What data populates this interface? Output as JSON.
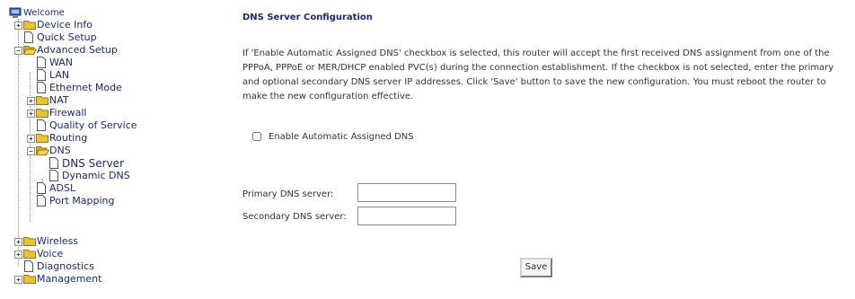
{
  "sidebar": {
    "items": [
      {
        "label": "Welcome"
      },
      {
        "label": "Device Info"
      },
      {
        "label": "Quick Setup"
      },
      {
        "label": "Advanced Setup"
      },
      {
        "label": "WAN"
      },
      {
        "label": "LAN"
      },
      {
        "label": "Ethernet Mode"
      },
      {
        "label": "NAT"
      },
      {
        "label": "Firewall"
      },
      {
        "label": "Quality of Service"
      },
      {
        "label": "Routing"
      },
      {
        "label": "DNS"
      },
      {
        "label": "DNS Server"
      },
      {
        "label": "Dynamic DNS"
      },
      {
        "label": "ADSL"
      },
      {
        "label": "Port Mapping"
      },
      {
        "label": "Wireless"
      },
      {
        "label": "Voice"
      },
      {
        "label": "Diagnostics"
      },
      {
        "label": "Management"
      }
    ]
  },
  "main": {
    "title": "DNS Server Configuration",
    "description": "If 'Enable Automatic Assigned DNS' checkbox is selected, this router will accept the first received DNS assignment from one of the PPPoA, PPPoE or MER/DHCP enabled PVC(s) during the connection establishment. If the checkbox is not selected, enter the primary and optional secondary DNS server IP addresses. Click 'Save' button to save the new configuration. You must reboot the router to make the new configuration effective.",
    "auto_dns": {
      "label": "Enable Automatic Assigned DNS",
      "checked": false
    },
    "primary_dns": {
      "label": "Primary DNS server:",
      "value": ""
    },
    "secondary_dns": {
      "label": "Secondary DNS server:",
      "value": ""
    },
    "save_label": "Save"
  },
  "colors": {
    "link": "#1a2a6e",
    "folder": "#e8c23a",
    "text": "#333333"
  }
}
